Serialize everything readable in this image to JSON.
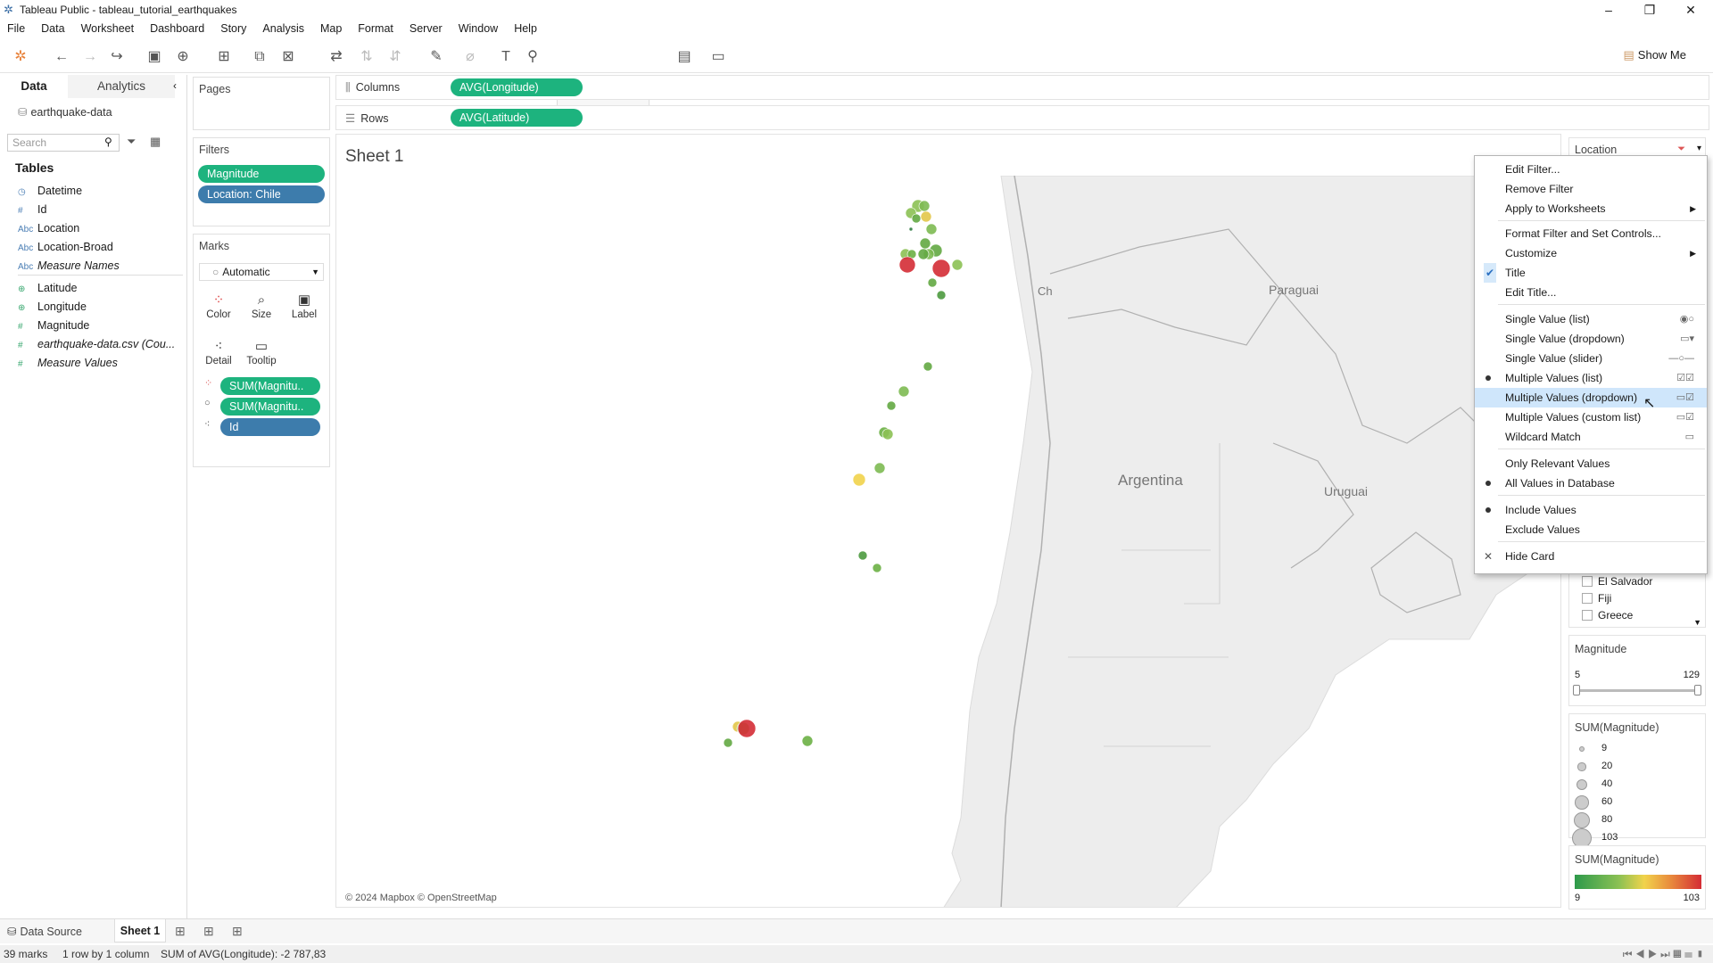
{
  "window": {
    "title": "Tableau Public - tableau_tutorial_earthquakes"
  },
  "menu": [
    "File",
    "Data",
    "Worksheet",
    "Dashboard",
    "Story",
    "Analysis",
    "Map",
    "Format",
    "Server",
    "Window",
    "Help"
  ],
  "toolbar": {
    "show_me": "Show Me"
  },
  "datapane": {
    "tab_data": "Data",
    "tab_analytics": "Analytics",
    "datasource": "earthquake-data",
    "search_placeholder": "Search",
    "tables_heading": "Tables",
    "fields": [
      {
        "icon": "date-icon",
        "label": "Datetime"
      },
      {
        "icon": "number-icon",
        "label": "Id"
      },
      {
        "icon": "abc-icon",
        "label": "Location"
      },
      {
        "icon": "abc-icon",
        "label": "Location-Broad"
      },
      {
        "icon": "abc-icon",
        "label": "Measure Names"
      },
      {
        "icon": "geo-icon",
        "label": "Latitude"
      },
      {
        "icon": "geo-icon",
        "label": "Longitude"
      },
      {
        "icon": "number-icon",
        "label": "Magnitude"
      },
      {
        "icon": "number-icon",
        "label": "earthquake-data.csv (Cou..."
      },
      {
        "icon": "number-icon",
        "label": "Measure Values"
      }
    ]
  },
  "cards": {
    "pages": "Pages",
    "filters": "Filters",
    "filter_pills": [
      "Magnitude",
      "Location: Chile"
    ],
    "marks": "Marks",
    "mark_type": "Automatic",
    "mark_buttons": [
      "Color",
      "Size",
      "Label",
      "Detail",
      "Tooltip"
    ],
    "mark_pills": [
      "SUM(Magnitu..",
      "SUM(Magnitu..",
      "Id"
    ]
  },
  "shelves": {
    "columns_label": "Columns",
    "columns_pill": "AVG(Longitude)",
    "rows_label": "Rows",
    "rows_pill": "AVG(Latitude)"
  },
  "view": {
    "sheet_title": "Sheet 1",
    "map_labels": [
      "Paraguai",
      "Argentina",
      "Uruguai",
      "Ch"
    ],
    "map_credit": "© 2024 Mapbox © OpenStreetMap"
  },
  "legends": {
    "location_title": "Location",
    "location_items": [
      "El Salvador",
      "Fiji",
      "Greece"
    ],
    "magnitude_title": "Magnitude",
    "magnitude_min": "5",
    "magnitude_max": "129",
    "size_title": "SUM(Magnitude)",
    "size_items": [
      "9",
      "20",
      "40",
      "60",
      "80",
      "103"
    ],
    "color_title": "SUM(Magnitude)",
    "color_min": "9",
    "color_max": "103"
  },
  "context_menu": {
    "items": [
      "Edit Filter...",
      "Remove Filter",
      "Apply to Worksheets",
      "Format Filter and Set Controls...",
      "Customize",
      "Title",
      "Edit Title...",
      "Single Value (list)",
      "Single Value (dropdown)",
      "Single Value (slider)",
      "Multiple Values (list)",
      "Multiple Values (dropdown)",
      "Multiple Values (custom list)",
      "Wildcard Match",
      "Only Relevant Values",
      "All Values in Database",
      "Include Values",
      "Exclude Values",
      "Hide Card"
    ]
  },
  "tabs": {
    "data_source": "Data Source",
    "sheet1": "Sheet 1"
  },
  "status": {
    "marks": "39 marks",
    "rows_cols": "1 row by 1 column",
    "sum": "SUM of AVG(Longitude): -2 787,83"
  },
  "colors": {
    "accent_green": "#1db37e",
    "pill_blue": "#3d7cac",
    "menu_highlight": "#cfe6fb"
  }
}
